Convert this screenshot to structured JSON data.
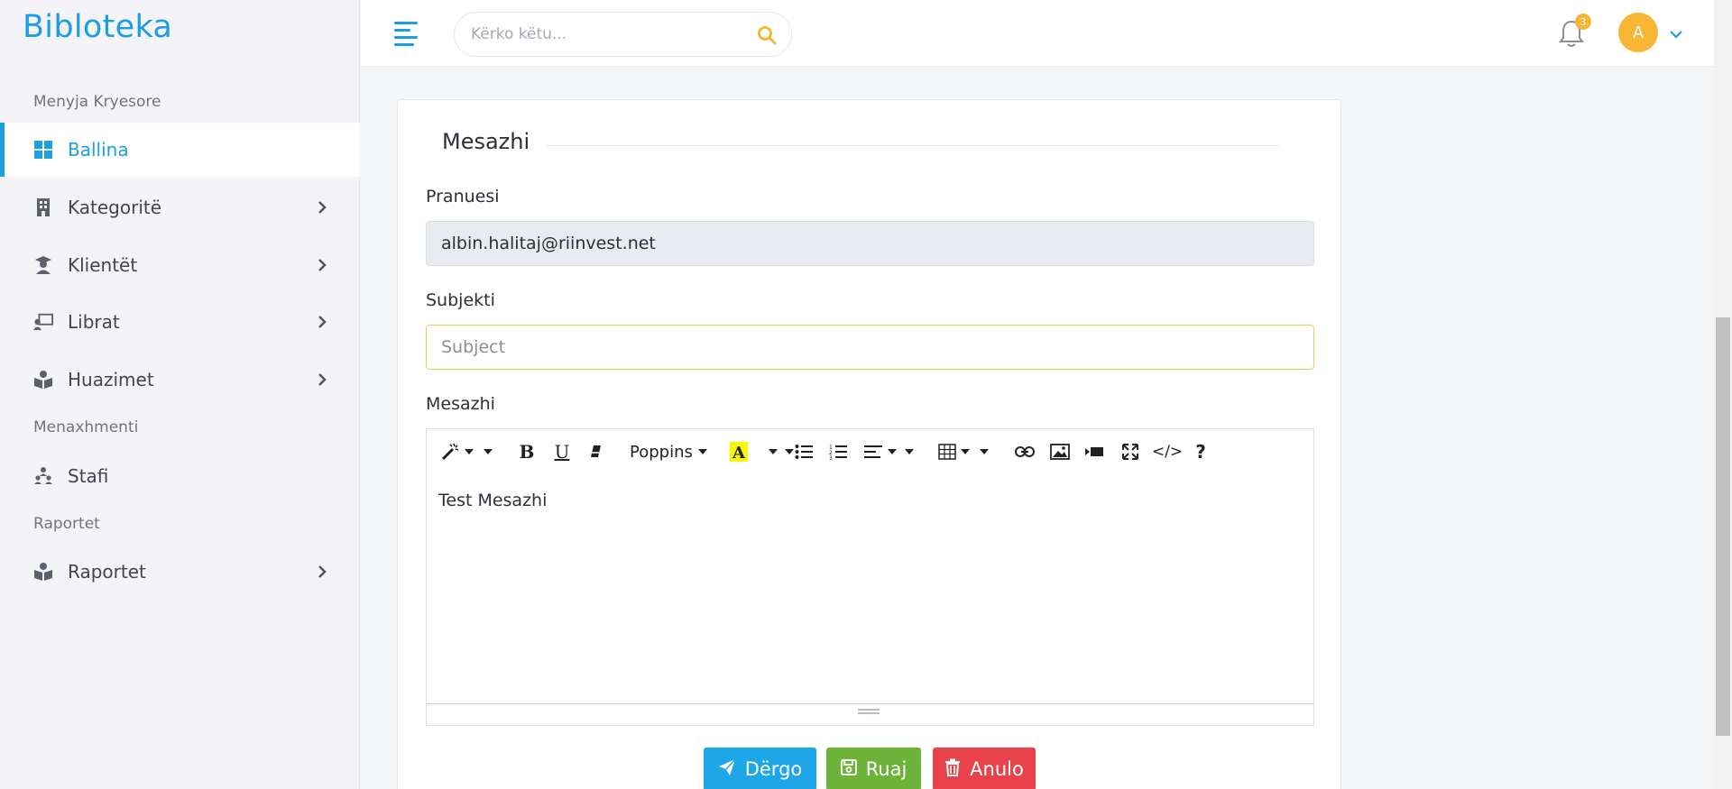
{
  "brand": "Bibloteka",
  "sidebar": {
    "sections": [
      {
        "label": "Menyja Kryesore"
      },
      {
        "label": "Menaxhmenti"
      },
      {
        "label": "Raportet"
      }
    ],
    "items": [
      {
        "label": "Ballina",
        "icon": "dashboard-icon",
        "active": true
      },
      {
        "label": "Kategoritë",
        "icon": "building-icon"
      },
      {
        "label": "Klientët",
        "icon": "graduate-icon"
      },
      {
        "label": "Librat",
        "icon": "teacher-icon"
      },
      {
        "label": "Huazimet",
        "icon": "book-reader-icon"
      },
      {
        "label": "Stafi",
        "icon": "people-icon"
      },
      {
        "label": "Raportet",
        "icon": "book-reader-icon"
      }
    ]
  },
  "header": {
    "search_placeholder": "Kërko këtu...",
    "notification_count": "3",
    "avatar_initial": "A"
  },
  "form": {
    "title": "Mesazhi",
    "recipient_label": "Pranuesi",
    "recipient_value": "albin.halitaj@riinvest.net",
    "subject_label": "Subjekti",
    "subject_placeholder": "Subject",
    "message_label": "Mesazhi",
    "editor_font": "Poppins",
    "editor_content": "Test Mesazhi",
    "code_view_label": "</>",
    "help_label": "?"
  },
  "buttons": {
    "send": "Dërgo",
    "save": "Ruaj",
    "cancel": "Anulo"
  },
  "colors": {
    "accent": "#1a9ee4",
    "warning": "#f7b633",
    "success": "#6eb339",
    "danger": "#e8434a"
  }
}
